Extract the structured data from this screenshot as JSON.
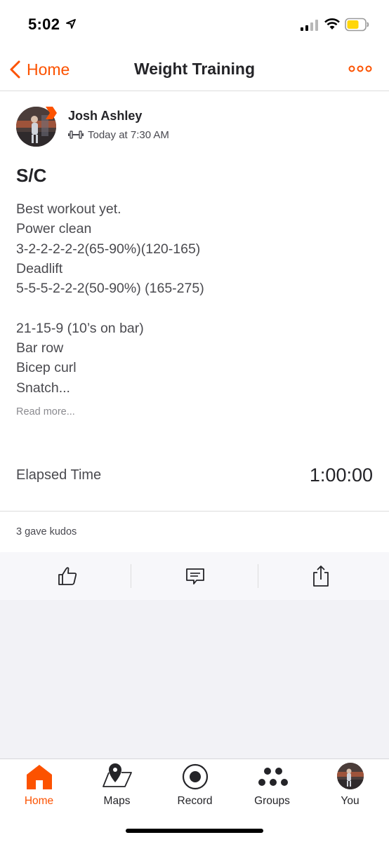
{
  "status_bar": {
    "time": "5:02"
  },
  "nav": {
    "back_label": "Home",
    "title": "Weight Training"
  },
  "athlete": {
    "name": "Josh Ashley",
    "activity_time": "Today at 7:30 AM"
  },
  "activity": {
    "title": "S/C",
    "description_lines": [
      "Best workout yet.",
      "Power clean",
      "3-2-2-2-2-2(65-90%)(120-165)",
      "Deadlift",
      "5-5-5-2-2-2(50-90%) (165-275)",
      "",
      "21-15-9 (10’s on bar)",
      "Bar row",
      "Bicep curl",
      "Snatch..."
    ],
    "read_more": "Read more...",
    "stat_label": "Elapsed Time",
    "stat_value": "1:00:00"
  },
  "kudos": {
    "text": "3 gave kudos"
  },
  "tabs": [
    {
      "label": "Home",
      "icon": "home-icon",
      "active": true
    },
    {
      "label": "Maps",
      "icon": "map-icon",
      "active": false
    },
    {
      "label": "Record",
      "icon": "record-icon",
      "active": false
    },
    {
      "label": "Groups",
      "icon": "groups-icon",
      "active": false
    },
    {
      "label": "You",
      "icon": "profile-avatar",
      "active": false
    }
  ],
  "colors": {
    "accent": "#fc5200",
    "text": "#242428",
    "muted": "#4a4a4f"
  }
}
